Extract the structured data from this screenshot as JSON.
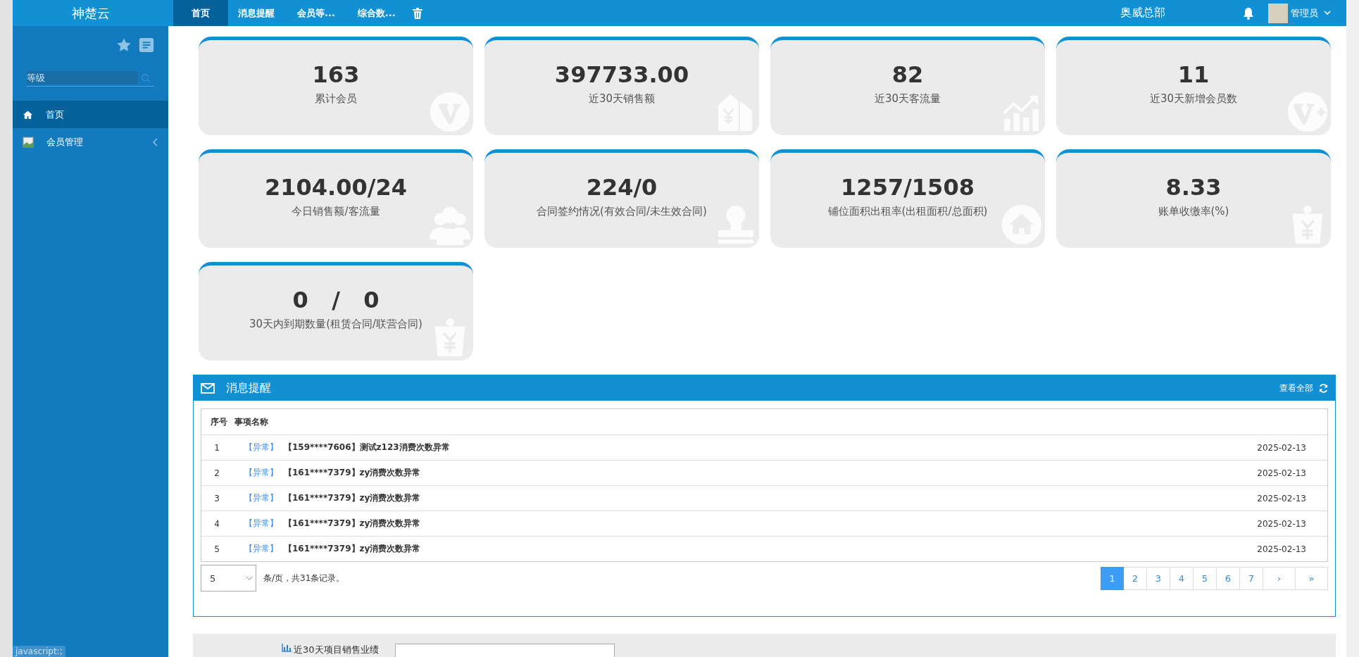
{
  "sidebar": {
    "brand": "神楚云",
    "search": {
      "value": "等级"
    },
    "items": [
      {
        "label": "首页",
        "kind": "home",
        "selected": true
      },
      {
        "label": "会员管理",
        "kind": "submenu",
        "selected": false
      }
    ]
  },
  "topbar": {
    "tabs": [
      {
        "label": "首页",
        "selected": true
      },
      {
        "label": "消息提醒",
        "selected": false
      },
      {
        "label": "会员等...",
        "selected": false
      },
      {
        "label": "综合数...",
        "selected": false
      }
    ],
    "org": "奥威总部",
    "user": "管理员"
  },
  "cards": [
    {
      "value": "163",
      "label": "累计会员",
      "kind": "v"
    },
    {
      "value": "397733.00",
      "label": "近30天销售额",
      "kind": "tag"
    },
    {
      "value": "82",
      "label": "近30天客流量",
      "kind": "chart"
    },
    {
      "value": "11",
      "label": "近30天新增会员数",
      "kind": "vplus"
    },
    {
      "value": "2104.00/24",
      "label": "今日销售额/客流量",
      "kind": "people"
    },
    {
      "value": "224/0",
      "label": "合同签约情况(有效合同/未生效合同)",
      "kind": "stamp"
    },
    {
      "value": "1257/1508",
      "label": "铺位面积出租率(出租面积/总面积)",
      "kind": "house"
    },
    {
      "value": "8.33",
      "label": "账单收缴率(%)",
      "kind": "bag"
    },
    {
      "value": "0   /   0",
      "label": "30天内到期数量(租赁合同/联营合同)",
      "kind": "bag"
    }
  ],
  "messages": {
    "title": "消息提醒",
    "view_all": "查看全部",
    "columns": [
      "序号",
      "事项名称"
    ],
    "rows": [
      {
        "no": "1",
        "tag": "【异常】",
        "text": "【159****7606】测试z123消费次数异常",
        "date": "2025-02-13"
      },
      {
        "no": "2",
        "tag": "【异常】",
        "text": "【161****7379】zy消费次数异常",
        "date": "2025-02-13"
      },
      {
        "no": "3",
        "tag": "【异常】",
        "text": "【161****7379】zy消费次数异常",
        "date": "2025-02-13"
      },
      {
        "no": "4",
        "tag": "【异常】",
        "text": "【161****7379】zy消费次数异常",
        "date": "2025-02-13"
      },
      {
        "no": "5",
        "tag": "【异常】",
        "text": "【161****7379】zy消费次数异常",
        "date": "2025-02-13"
      }
    ],
    "page_size": "5",
    "summary": "条/页，共31条记录。",
    "pages": [
      {
        "label": "1",
        "selected": true
      },
      {
        "label": "2",
        "selected": false
      },
      {
        "label": "3",
        "selected": false
      },
      {
        "label": "4",
        "selected": false
      },
      {
        "label": "5",
        "selected": false
      },
      {
        "label": "6",
        "selected": false
      },
      {
        "label": "7",
        "selected": false
      },
      {
        "label": "›",
        "selected": false
      },
      {
        "label": "»",
        "selected": false
      }
    ]
  },
  "sales_panel": {
    "title": "近30天项目销售业绩"
  },
  "status_tip": "javascript:;"
}
